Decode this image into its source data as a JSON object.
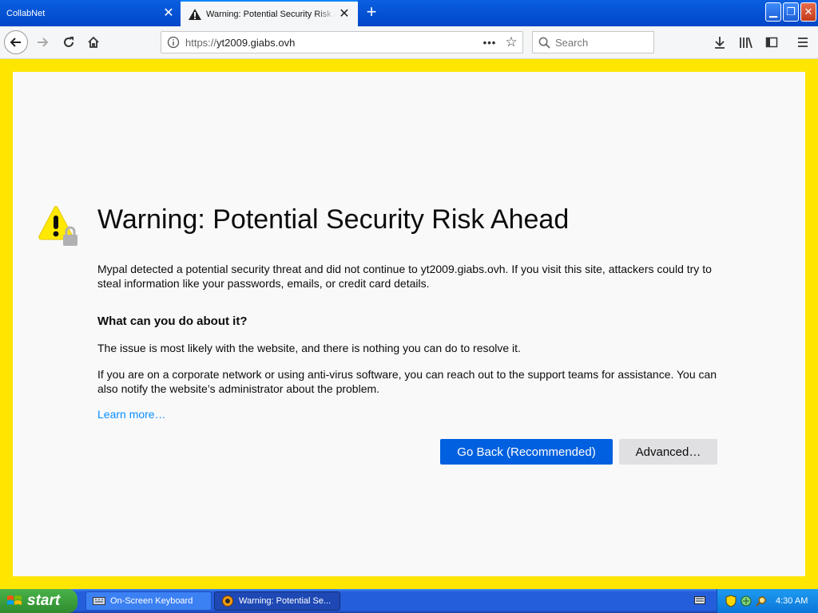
{
  "tabs": [
    {
      "title": "CollabNet",
      "active": false
    },
    {
      "title": "Warning: Potential Security Risk Ahead",
      "active": true
    }
  ],
  "window_controls": [
    "minimize",
    "restore",
    "close"
  ],
  "nav": {
    "url_protocol": "https://",
    "url_host": "yt2009.giabs.ovh",
    "search_placeholder": "Search"
  },
  "page": {
    "title": "Warning: Potential Security Risk Ahead",
    "intro": "Mypal detected a potential security threat and did not continue to yt2009.giabs.ovh. If you visit this site, attackers could try to steal information like your passwords, emails, or credit card details.",
    "subheading": "What can you do about it?",
    "para1": "The issue is most likely with the website, and there is nothing you can do to resolve it.",
    "para2": "If you are on a corporate network or using anti-virus software, you can reach out to the support teams for assistance. You can also notify the website’s administrator about the problem.",
    "learn_more": "Learn more…",
    "primary_button": "Go Back (Recommended)",
    "secondary_button": "Advanced…"
  },
  "taskbar": {
    "start_label": "start",
    "tasks": [
      {
        "label": "On-Screen Keyboard"
      },
      {
        "label": "Warning: Potential Se..."
      }
    ],
    "clock": "4:30 AM"
  },
  "colors": {
    "frame_border": "#ffe600",
    "primary_button": "#0060df",
    "link": "#0a8dff"
  }
}
